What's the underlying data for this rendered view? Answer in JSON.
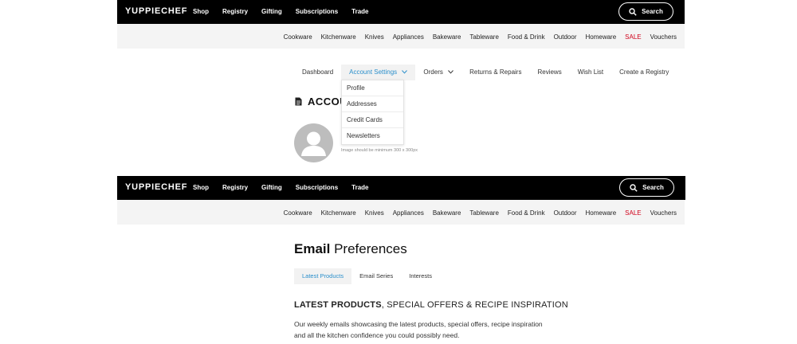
{
  "header": {
    "logo": "YUPPIECHEF",
    "nav": [
      "Shop",
      "Registry",
      "Gifting",
      "Subscriptions",
      "Trade"
    ],
    "search_label": "Search"
  },
  "categories": [
    "Cookware",
    "Kitchenware",
    "Knives",
    "Appliances",
    "Bakeware",
    "Tableware",
    "Food & Drink",
    "Outdoor",
    "Homeware",
    "SALE",
    "Vouchers"
  ],
  "account": {
    "nav": {
      "dashboard": "Dashboard",
      "account_settings": "Account Settings",
      "orders": "Orders",
      "returns": "Returns & Repairs",
      "reviews": "Reviews",
      "wishlist": "Wish List",
      "registry": "Create a Registry"
    },
    "dropdown": [
      "Profile",
      "Addresses",
      "Credit Cards",
      "Newsletters"
    ],
    "title": "ACCOU",
    "image_hint": "Image should be minimum 300 x 300px"
  },
  "email": {
    "title_bold": "Email",
    "title_rest": " Preferences",
    "tabs": [
      "Latest Products",
      "Email Series",
      "Interests"
    ],
    "section_bold": "LATEST PRODUCTS",
    "section_rest": ", SPECIAL OFFERS & RECIPE INSPIRATION",
    "description": "Our weekly emails showcasing the latest products, special offers, recipe inspiration and all the kitchen confidence you could possibly need."
  },
  "colors": {
    "accent": "#2a8fcb",
    "sale": "#d0021b",
    "topbar": "#000000"
  }
}
